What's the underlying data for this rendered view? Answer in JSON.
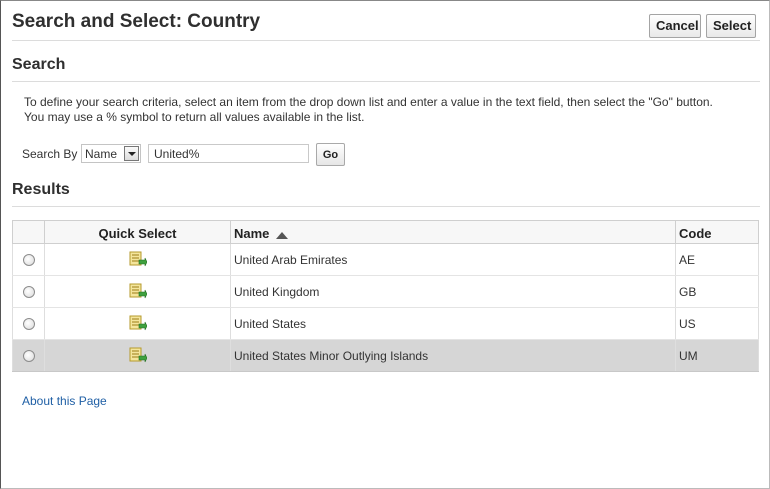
{
  "page": {
    "title": "Search and Select: Country"
  },
  "buttons": {
    "cancel_label": "Cancel",
    "select_label": "Select"
  },
  "search": {
    "header": "Search",
    "instructions_line1": "To define your search criteria, select an item from the drop down list and enter a value in the text field, then select the \"Go\" button.",
    "instructions_line2": "You may use a % symbol to return all values available in the list.",
    "search_by_label": "Search By",
    "search_by_value": "Name",
    "query_value": "United%",
    "go_label": "Go"
  },
  "results": {
    "header": "Results",
    "columns": {
      "quick_select": "Quick Select",
      "name": "Name",
      "code": "Code"
    },
    "sort": {
      "column": "name",
      "direction": "ascending"
    },
    "rows": [
      {
        "name": "United Arab Emirates",
        "code": "AE",
        "selected": false
      },
      {
        "name": "United Kingdom",
        "code": "GB",
        "selected": false
      },
      {
        "name": "United States",
        "code": "US",
        "selected": false
      },
      {
        "name": "United States Minor Outlying Islands",
        "code": "UM",
        "selected": true
      }
    ],
    "quick_select_icon": "quick-select-icon"
  },
  "footer": {
    "about_label": "About this Page"
  },
  "colors": {
    "link": "#1f5fa5",
    "selected_row": "#d6d6d6"
  }
}
